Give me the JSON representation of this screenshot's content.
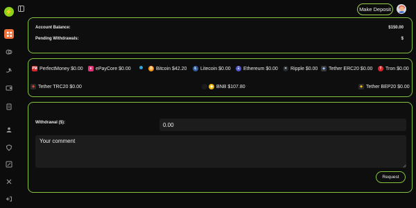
{
  "header": {
    "deposit_label": "Make Deposit"
  },
  "balance": {
    "account_label": "Account Balance:",
    "account_value": "$150.00",
    "pending_label": "Pending Withdrawals:",
    "pending_value": "$"
  },
  "assets": [
    {
      "name": "PerfectMoney",
      "amount": "$0.00",
      "icon": "perfectmoney-icon",
      "color": "#d9262c"
    },
    {
      "name": "ePayCore",
      "amount": "$0.00",
      "icon": "epaycore-icon",
      "color": "#e0357a"
    },
    {
      "name": "",
      "amount": "",
      "icon": "unknown-coin-icon",
      "color": "#2fa8e0"
    },
    {
      "name": "Bitcoin",
      "amount": "$42.20",
      "icon": "bitcoin-icon",
      "color": "#f7931a"
    },
    {
      "name": "Litecoin",
      "amount": "$0.00",
      "icon": "litecoin-icon",
      "color": "#345d9d"
    },
    {
      "name": "Ethereum",
      "amount": "$0.00",
      "icon": "ethereum-icon",
      "color": "#4f58c8"
    },
    {
      "name": "Ripple",
      "amount": "$0.00",
      "icon": "ripple-icon",
      "color": "#23292f"
    },
    {
      "name": "Tether ERC20",
      "amount": "$0.00",
      "icon": "tether-erc20-icon",
      "color": "#3a3a3a"
    },
    {
      "name": "Tron",
      "amount": "$0.00",
      "icon": "tron-icon",
      "color": "#d8262c"
    },
    {
      "name": "Tether TRC20",
      "amount": "$0.00",
      "icon": "tether-trc20-icon",
      "color": "#2a2a2a"
    },
    {
      "name": "BNB",
      "amount": "$107.80",
      "icon": "bnb-icon",
      "color": "#f0b90b"
    },
    {
      "name": "Tether BEP20",
      "amount": "$0.00",
      "icon": "tether-bep20-icon",
      "color": "#f0b90b"
    }
  ],
  "withdraw": {
    "label": "Withdrawal ($):",
    "amount_value": "0.00",
    "comment_placeholder": "Your comment",
    "request_label": "Request"
  },
  "colors": {
    "accent": "#86c33f",
    "logo": "#8bd418",
    "active_nav": "#f0703a",
    "background": "#0c0c0c"
  }
}
